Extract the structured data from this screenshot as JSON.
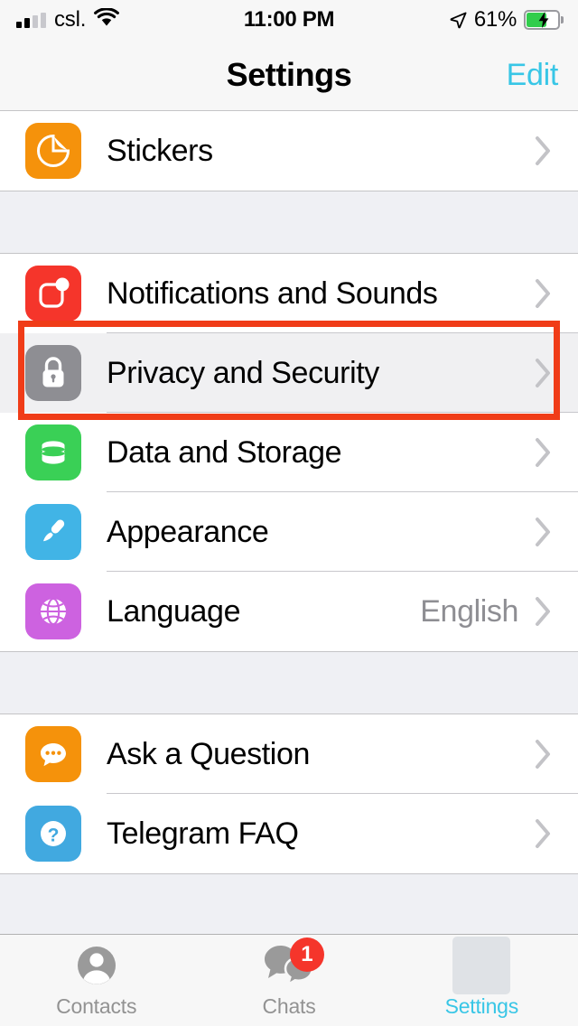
{
  "status_bar": {
    "carrier": "csl.",
    "signal_bars_filled": 2,
    "signal_bars_total": 4,
    "wifi_icon": "wifi-icon",
    "time": "11:00 PM",
    "location_icon": "location-arrow-icon",
    "battery_percent": "61%",
    "battery_level": 61,
    "battery_charging": true
  },
  "nav": {
    "title": "Settings",
    "edit_label": "Edit",
    "accent_color": "#38c6e6"
  },
  "sections": [
    {
      "rows": [
        {
          "label": "Stickers",
          "icon": "sticker-icon",
          "icon_color": "#f5920b",
          "value": "",
          "highlighted": false
        }
      ]
    },
    {
      "rows": [
        {
          "label": "Notifications and Sounds",
          "icon": "notifications-icon",
          "icon_color": "#f5352b",
          "value": "",
          "highlighted": false
        },
        {
          "label": "Privacy and Security",
          "icon": "lock-icon",
          "icon_color": "#8e8e93",
          "value": "",
          "highlighted": true
        },
        {
          "label": "Data and Storage",
          "icon": "database-icon",
          "icon_color": "#3ad056",
          "value": "",
          "highlighted": false
        },
        {
          "label": "Appearance",
          "icon": "paintbrush-icon",
          "icon_color": "#41b4e6",
          "value": "",
          "highlighted": false
        },
        {
          "label": "Language",
          "icon": "globe-icon",
          "icon_color": "#cd62e0",
          "value": "English",
          "highlighted": false
        }
      ]
    },
    {
      "rows": [
        {
          "label": "Ask a Question",
          "icon": "speech-bubble-icon",
          "icon_color": "#f5920b",
          "value": "",
          "highlighted": false
        },
        {
          "label": "Telegram FAQ",
          "icon": "question-mark-icon",
          "icon_color": "#41a9e0",
          "value": "",
          "highlighted": false
        }
      ]
    }
  ],
  "tabs": [
    {
      "label": "Contacts",
      "icon": "contact-person-icon",
      "badge": "",
      "active": false
    },
    {
      "label": "Chats",
      "icon": "chat-bubbles-icon",
      "badge": "1",
      "active": false
    },
    {
      "label": "Settings",
      "icon": "settings-avatar-placeholder-icon",
      "badge": "",
      "active": true
    }
  ],
  "annotation": {
    "target_row": "Privacy and Security",
    "box_color": "#f03c18"
  }
}
